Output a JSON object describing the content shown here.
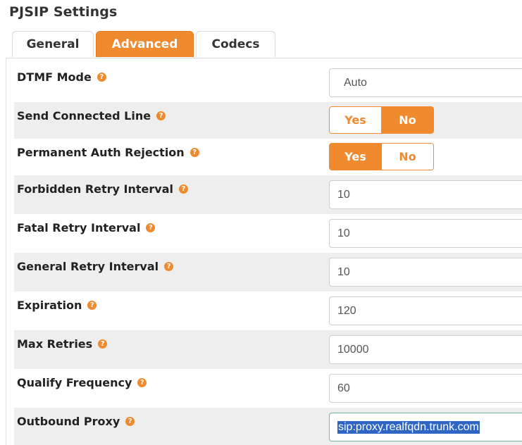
{
  "page_title": "PJSIP Settings",
  "tabs": [
    {
      "label": "General"
    },
    {
      "label": "Advanced"
    },
    {
      "label": "Codecs"
    }
  ],
  "active_tab": "Advanced",
  "accent_color": "#f08a2e",
  "help_icon": {
    "name": "question-circle-icon",
    "glyph": "?"
  },
  "settings": {
    "dtmf_mode": {
      "label": "DTMF Mode",
      "value": "Auto"
    },
    "send_connected_line": {
      "label": "Send Connected Line",
      "yes": "Yes",
      "no": "No",
      "selected": "No"
    },
    "permanent_auth_rejection": {
      "label": "Permanent Auth Rejection",
      "yes": "Yes",
      "no": "No",
      "selected": "Yes"
    },
    "forbidden_retry_interval": {
      "label": "Forbidden Retry Interval",
      "value": "10"
    },
    "fatal_retry_interval": {
      "label": "Fatal Retry Interval",
      "value": "10"
    },
    "general_retry_interval": {
      "label": "General Retry Interval",
      "value": "10"
    },
    "expiration": {
      "label": "Expiration",
      "value": "120"
    },
    "max_retries": {
      "label": "Max Retries",
      "value": "10000"
    },
    "qualify_frequency": {
      "label": "Qualify Frequency",
      "value": "60"
    },
    "outbound_proxy": {
      "label": "Outbound Proxy",
      "value": "sip:proxy.realfqdn.trunk.com"
    }
  }
}
